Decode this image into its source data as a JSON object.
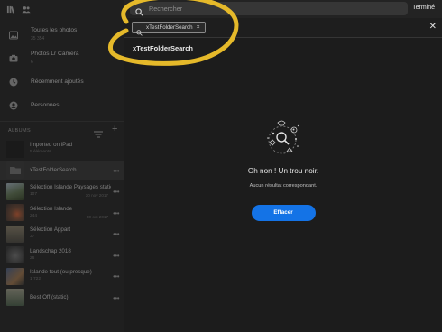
{
  "sidebar": {
    "library": [
      {
        "name": "Toutes les photos",
        "count": "35 354",
        "icon": "photos-icon"
      },
      {
        "name": "Photos Lr Camera",
        "count": "6",
        "icon": "camera-icon"
      },
      {
        "name": "Récemment ajoutés",
        "count": "",
        "icon": "clock-icon"
      },
      {
        "name": "Personnes",
        "count": "",
        "icon": "people-icon"
      }
    ],
    "albums_label": "ALBUMS",
    "albums": [
      {
        "name": "Imported on iPad",
        "count": "5 éléments",
        "right": ""
      },
      {
        "name": "xTestFolderSearch",
        "count": "",
        "right": ""
      },
      {
        "name": "Sélection Islande Paysages static",
        "count": "107",
        "right": "30 nov 2017"
      },
      {
        "name": "Sélection Islande",
        "count": "244",
        "right": "30 oct 2017"
      },
      {
        "name": "Sélection Appart",
        "count": "37",
        "right": ""
      },
      {
        "name": "Landschap 2018",
        "count": "26",
        "right": ""
      },
      {
        "name": "Islande tout (ou presque)",
        "count": "1 722",
        "right": ""
      },
      {
        "name": "Best Off (static)",
        "count": "",
        "right": ""
      }
    ]
  },
  "search": {
    "placeholder": "Rechercher",
    "value": "",
    "done_label": "Terminé",
    "chip_label": "xTestFolderSearch",
    "suggestion": "xTestFolderSearch"
  },
  "empty_state": {
    "title": "Oh non ! Un trou noir.",
    "subtitle": "Aucun résultat correspondant.",
    "clear_label": "Effacer"
  },
  "colors": {
    "accent": "#1473e6",
    "annotation": "#e5b92a"
  }
}
